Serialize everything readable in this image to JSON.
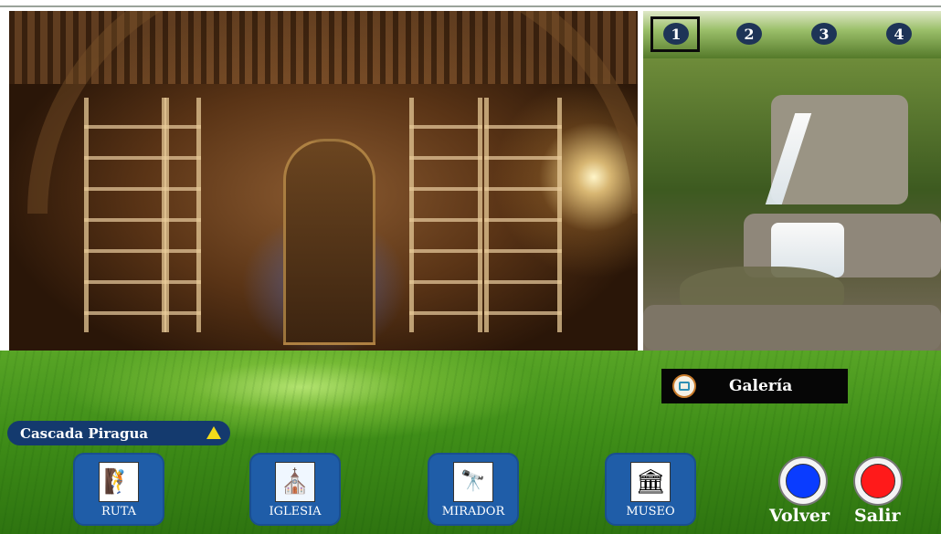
{
  "gallery_thumbs": [
    "1",
    "2",
    "3",
    "4"
  ],
  "gallery_button": {
    "label": "Galería",
    "icon": "camera-icon"
  },
  "location_bar": {
    "label": "Cascada Piragua",
    "icon": "triangle-up-icon"
  },
  "nav_buttons": [
    {
      "label": "RUTA",
      "icon": "hiker-map-icon"
    },
    {
      "label": "IGLESIA",
      "icon": "church-icon"
    },
    {
      "label": "MIRADOR",
      "icon": "binoculars-icon"
    },
    {
      "label": "MUSEO",
      "icon": "museum-icon"
    }
  ],
  "actions": {
    "back_label": "Volver",
    "exit_label": "Salir",
    "back_color": "#0a3cff",
    "exit_color": "#ff1a1a"
  },
  "colors": {
    "nav_button_bg": "#1f5da8",
    "location_bar_bg": "#143a6e",
    "thumb_badge_bg": "#1e3457",
    "gallery_bar_bg": "#060606"
  }
}
